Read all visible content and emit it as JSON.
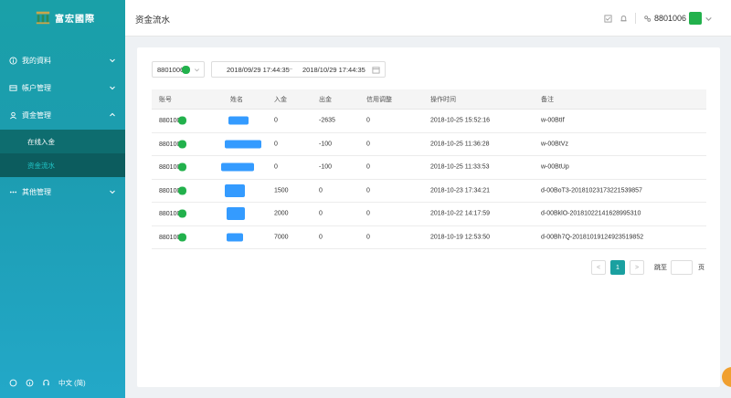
{
  "sidebar": {
    "logo_text": "富宏國際",
    "items": [
      {
        "label": "我的資料",
        "icon": "info-icon"
      },
      {
        "label": "帳户管理",
        "icon": "card-icon"
      },
      {
        "label": "資金管理",
        "icon": "user-icon"
      },
      {
        "label": "其他管理",
        "icon": "ellipsis-icon"
      }
    ],
    "subitems": [
      {
        "label": "在线入金"
      },
      {
        "label": "资金流水"
      }
    ],
    "footer": {
      "language": "中文 (简)"
    }
  },
  "header": {
    "title": "资金流水",
    "user": "8801006"
  },
  "filters": {
    "account": "8801006",
    "date_start": "2018/09/29 17:44:35",
    "date_sep": "~",
    "date_end": "2018/10/29 17:44:35"
  },
  "table": {
    "columns": [
      "账号",
      "姓名",
      "入金",
      "出金",
      "信用调整",
      "操作时间",
      "备注"
    ],
    "rows": [
      {
        "account": "880100",
        "deposit": "0",
        "withdraw": "-2635",
        "credit": "0",
        "time": "2018-10-25 15:52:16",
        "note": "w-00BtIf"
      },
      {
        "account": "880100",
        "deposit": "0",
        "withdraw": "-100",
        "credit": "0",
        "time": "2018-10-25 11:36:28",
        "note": "w-00BtVz"
      },
      {
        "account": "880100",
        "deposit": "0",
        "withdraw": "-100",
        "credit": "0",
        "time": "2018-10-25 11:33:53",
        "note": "w-00BtUp"
      },
      {
        "account": "880100",
        "deposit": "1500",
        "withdraw": "0",
        "credit": "0",
        "time": "2018-10-23 17:34:21",
        "note": "d-00BoT3-20181023173221539857"
      },
      {
        "account": "880100",
        "deposit": "2000",
        "withdraw": "0",
        "credit": "0",
        "time": "2018-10-22 14:17:59",
        "note": "d-00BklO-20181022141628995310"
      },
      {
        "account": "880100",
        "deposit": "7000",
        "withdraw": "0",
        "credit": "0",
        "time": "2018-10-19 12:53:50",
        "note": "d-00Bh7Q-20181019124923519852"
      }
    ]
  },
  "pager": {
    "prev": "<",
    "current": "1",
    "next": ">",
    "goto_label": "跳至",
    "page_label": "页"
  },
  "colors": {
    "accent": "#1aa0a8",
    "submenu_bg": "#0e6d6f",
    "active_text": "#21c6c8"
  }
}
